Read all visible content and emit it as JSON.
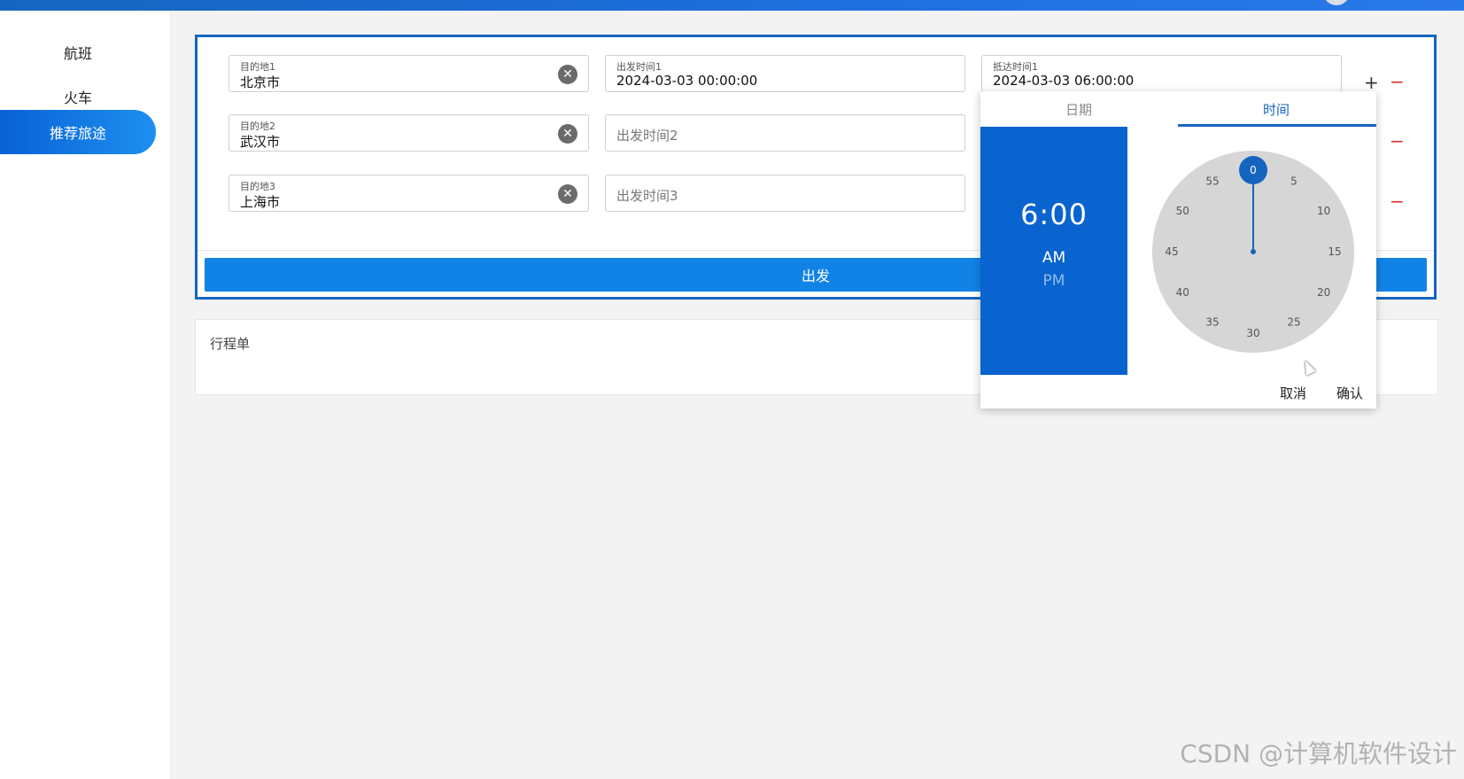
{
  "sidebar": {
    "items": [
      {
        "label": "航班"
      },
      {
        "label": "火车"
      },
      {
        "label": "推荐旅途",
        "active": true
      }
    ]
  },
  "form": {
    "rows": [
      {
        "destination_label": "目的地1",
        "destination_value": "北京市",
        "depart_label": "出发时间1",
        "depart_value": "2024-03-03 00:00:00",
        "arrive_label": "抵达时间1",
        "arrive_value": "2024-03-03 06:00:00"
      },
      {
        "destination_label": "目的地2",
        "destination_value": "武汉市",
        "depart_placeholder": "出发时间2"
      },
      {
        "destination_label": "目的地3",
        "destination_value": "上海市",
        "depart_placeholder": "出发时间3"
      }
    ],
    "add_label": "+",
    "remove_label": "−",
    "submit_label": "出发"
  },
  "itinerary": {
    "title": "行程单"
  },
  "time_picker": {
    "tab_date": "日期",
    "tab_time": "时间",
    "display_time": "6:00",
    "am": "AM",
    "pm": "PM",
    "selected_minute": 0,
    "minute_labels": [
      "0",
      "5",
      "10",
      "15",
      "20",
      "25",
      "30",
      "35",
      "40",
      "45",
      "50",
      "55"
    ],
    "cancel_label": "取消",
    "confirm_label": "确认"
  },
  "watermark": "CSDN @计算机软件设计",
  "colors": {
    "accent": "#1565c0",
    "primary_button": "#1283e6",
    "time_panel": "#0a64cf",
    "remove": "#dd3333"
  }
}
